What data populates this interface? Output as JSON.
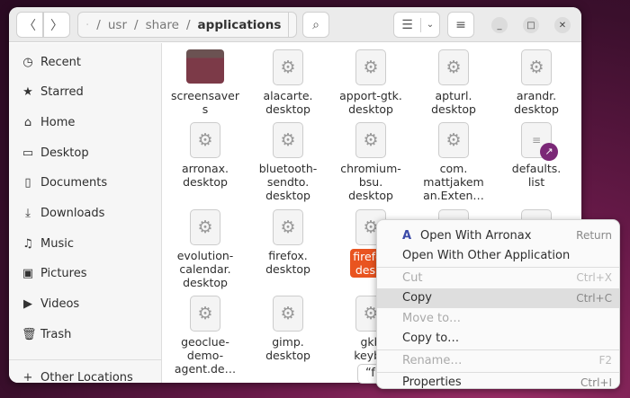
{
  "path": {
    "segments": [
      "usr",
      "share"
    ],
    "current": "applications"
  },
  "sidebar": {
    "items": [
      {
        "label": "Recent",
        "icon": "clock-icon",
        "glyph": "◷"
      },
      {
        "label": "Starred",
        "icon": "star-icon",
        "glyph": "★"
      },
      {
        "label": "Home",
        "icon": "home-icon",
        "glyph": "⌂"
      },
      {
        "label": "Desktop",
        "icon": "desktop-icon",
        "glyph": "▭"
      },
      {
        "label": "Documents",
        "icon": "document-icon",
        "glyph": "▯"
      },
      {
        "label": "Downloads",
        "icon": "download-icon",
        "glyph": "⤓"
      },
      {
        "label": "Music",
        "icon": "music-icon",
        "glyph": "♫"
      },
      {
        "label": "Pictures",
        "icon": "picture-icon",
        "glyph": "▣"
      },
      {
        "label": "Videos",
        "icon": "video-icon",
        "glyph": "▶"
      },
      {
        "label": "Trash",
        "icon": "trash-icon",
        "glyph": "🗑"
      }
    ],
    "other": {
      "label": "Other Locations",
      "glyph": "+"
    }
  },
  "files": [
    [
      "screensaver\ns",
      "folder"
    ],
    [
      "alacarte.\ndesktop",
      "app"
    ],
    [
      "apport-gtk.\ndesktop",
      "app"
    ],
    [
      "apturl.\ndesktop",
      "app"
    ],
    [
      "arandr.\ndesktop",
      "app"
    ],
    [
      "arronax.\ndesktop",
      "app"
    ],
    [
      "bluetooth-\nsendto.\ndesktop",
      "app"
    ],
    [
      "chromium-\nbsu.\ndesktop",
      "app"
    ],
    [
      "com.\nmattjakem\nan.Exten…",
      "app"
    ],
    [
      "defaults.\nlist",
      "doc"
    ],
    [
      "evolution-\ncalendar.\ndesktop",
      "app"
    ],
    [
      "firefox.\ndesktop",
      "app"
    ],
    [
      "firefox\ndeskt",
      "selected"
    ],
    [
      "",
      "app"
    ],
    [
      "",
      "app"
    ],
    [
      "geoclue-\ndemo-\nagent.de…",
      "app"
    ],
    [
      "gimp.\ndesktop",
      "app"
    ],
    [
      "gkb\nkeybo\ndis",
      "app"
    ]
  ],
  "tooltip": "“f",
  "context_menu": [
    {
      "label": "Open With Arronax",
      "key": "Return",
      "icon": "arronax-icon"
    },
    {
      "label": "Open With Other Application",
      "key": ""
    },
    {
      "sep": true
    },
    {
      "label": "Cut",
      "key": "Ctrl+X",
      "disabled": true
    },
    {
      "label": "Copy",
      "key": "Ctrl+C",
      "highlight": true
    },
    {
      "label": "Move to…",
      "key": "",
      "disabled": true
    },
    {
      "label": "Copy to…",
      "key": ""
    },
    {
      "sep": true
    },
    {
      "label": "Rename…",
      "key": "F2",
      "disabled": true
    },
    {
      "sep": true
    },
    {
      "label": "Properties",
      "key": "Ctrl+I"
    }
  ]
}
